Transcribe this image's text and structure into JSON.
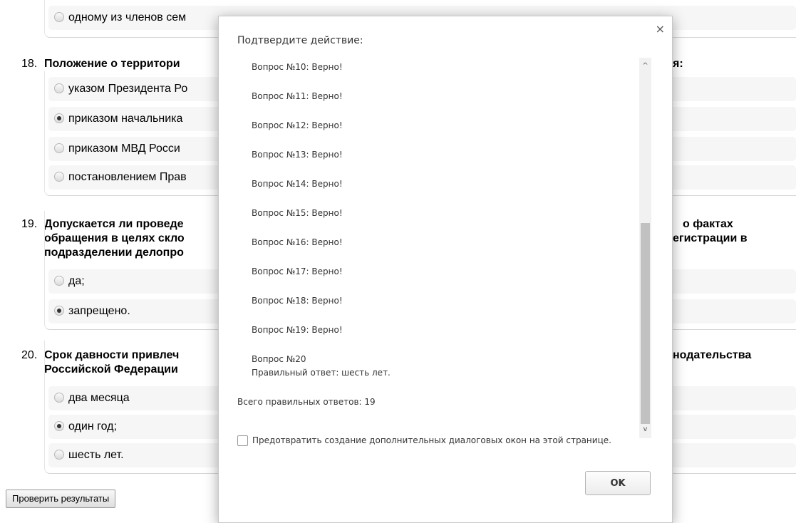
{
  "quiz": {
    "q17_tail_option": "одному из членов сем",
    "q18": {
      "number": "18.",
      "title_left": "Положение о территори",
      "title_right": "я:",
      "options": [
        {
          "label": "указом Президента Ро",
          "checked": false
        },
        {
          "label": "приказом начальника",
          "checked": true
        },
        {
          "label": "приказом МВД Росси",
          "checked": false
        },
        {
          "label": "постановлением Прав",
          "checked": false
        }
      ]
    },
    "q19": {
      "number": "19.",
      "title_left_1": "Допускается ли проведе",
      "title_left_2": "обращения в целях скло",
      "title_left_3": "подразделении делопро",
      "title_right_1": "о фактах",
      "title_right_2": "егистрации в",
      "options": [
        {
          "label": "да;",
          "checked": false
        },
        {
          "label": "запрещено.",
          "checked": true
        }
      ]
    },
    "q20": {
      "number": "20.",
      "title_left_1": "Срок давности привлеч",
      "title_left_2": "Российской Федерации",
      "title_right_1": "нодательства",
      "options": [
        {
          "label": "два месяца",
          "checked": false
        },
        {
          "label": "один год;",
          "checked": true
        },
        {
          "label": "шесть лет.",
          "checked": false
        }
      ]
    },
    "check_button": "Проверить результаты"
  },
  "dialog": {
    "title": "Подтвердите действие:",
    "close_glyph": "×",
    "lines": [
      "Вопрос №10: Верно!",
      "Вопрос №11: Верно!",
      "Вопрос №12: Верно!",
      "Вопрос №13: Верно!",
      "Вопрос №14: Верно!",
      "Вопрос №15: Верно!",
      "Вопрос №16: Верно!",
      "Вопрос №17: Верно!",
      "Вопрос №18: Верно!",
      "Вопрос №19: Верно!",
      "Вопрос №20",
      "Правильный ответ: шесть лет."
    ],
    "total": "Всего правильных ответов: 19",
    "prevent_checkbox": "Предотвратить создание дополнительных диалоговых окон на этой странице.",
    "ok_button": "OK",
    "scroll_up_glyph": "^",
    "scroll_down_glyph": "v"
  }
}
